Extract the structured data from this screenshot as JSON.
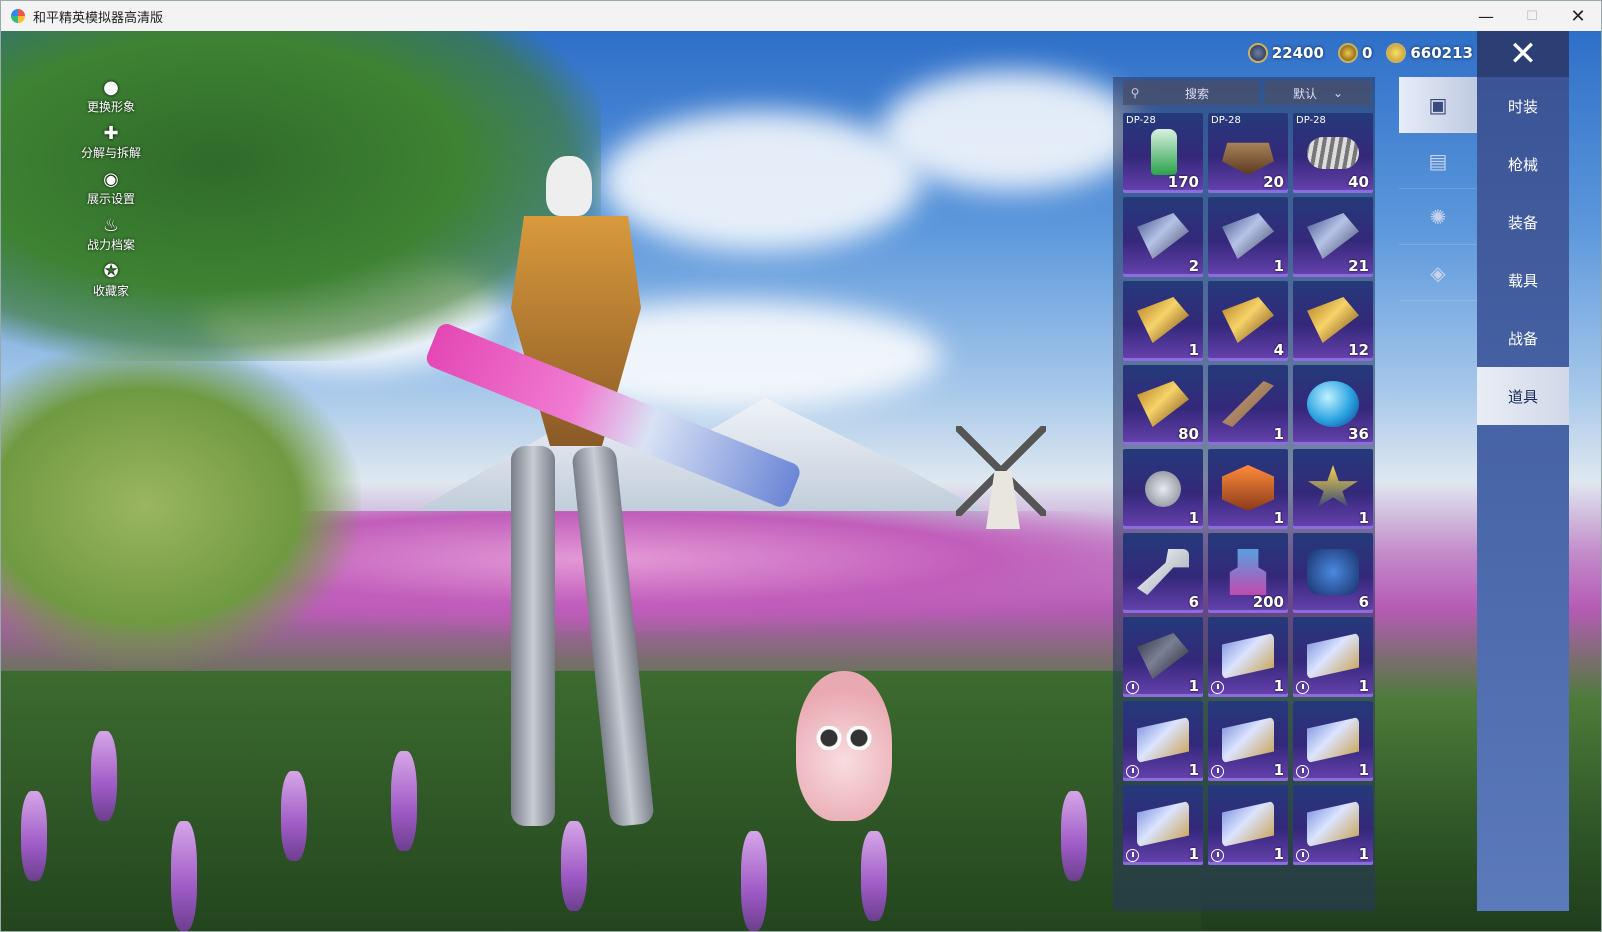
{
  "window": {
    "title": "和平精英模拟器高清版",
    "minimize": "—",
    "maximize": "☐",
    "close": "✕"
  },
  "left_menu": [
    {
      "label": "更换形象",
      "icon": "person-icon"
    },
    {
      "label": "分解与拆解",
      "icon": "puzzle-icon"
    },
    {
      "label": "展示设置",
      "icon": "eye-icon"
    },
    {
      "label": "战力档案",
      "icon": "fire-icon"
    },
    {
      "label": "收藏家",
      "icon": "collector-badge-icon"
    }
  ],
  "currency": [
    {
      "value": "22400",
      "icon": "silver-coin-icon",
      "color": "#6f7fa3"
    },
    {
      "value": "0",
      "icon": "gold-triangle-coin-icon",
      "color": "#f1c94a"
    },
    {
      "value": "660213",
      "icon": "gold-coin-icon",
      "color": "#f7e06d"
    }
  ],
  "search": {
    "placeholder": "搜索"
  },
  "sort": {
    "selected": "默认"
  },
  "tabs": [
    {
      "icon": "card-icon",
      "active": true
    },
    {
      "icon": "chest-icon",
      "active": false
    },
    {
      "icon": "firework-icon",
      "active": false
    },
    {
      "icon": "ticket-icon",
      "active": false
    }
  ],
  "categories": [
    {
      "label": "时装"
    },
    {
      "label": "枪械"
    },
    {
      "label": "装备"
    },
    {
      "label": "载具"
    },
    {
      "label": "战备"
    },
    {
      "label": "道具",
      "active": true
    }
  ],
  "close_label": "✕",
  "items": [
    {
      "tag": "DP-28",
      "count": "170",
      "icon": "spray-can",
      "timed": false
    },
    {
      "tag": "DP-28",
      "count": "20",
      "icon": "crate",
      "timed": false
    },
    {
      "tag": "DP-28",
      "count": "40",
      "icon": "spring",
      "timed": false
    },
    {
      "tag": "",
      "count": "2",
      "icon": "exp-card-1day-x1.5",
      "timed": false
    },
    {
      "tag": "",
      "count": "1",
      "icon": "exp-card-3day-x1.5",
      "timed": false
    },
    {
      "tag": "",
      "count": "21",
      "icon": "exp-card-3day-x2",
      "timed": false
    },
    {
      "tag": "",
      "count": "1",
      "icon": "gold-card-1day-x1.5",
      "timed": false
    },
    {
      "tag": "",
      "count": "4",
      "icon": "gold-card-1day-x2",
      "timed": false
    },
    {
      "tag": "",
      "count": "12",
      "icon": "gold-card-3day-x2",
      "timed": false
    },
    {
      "tag": "",
      "count": "80",
      "icon": "gold-card-2hour-x2",
      "timed": false
    },
    {
      "tag": "",
      "count": "1",
      "icon": "wooden-stick",
      "timed": false
    },
    {
      "tag": "",
      "count": "36",
      "icon": "puzzle-orb",
      "timed": false
    },
    {
      "tag": "",
      "count": "1",
      "icon": "thumbs-coin",
      "timed": false
    },
    {
      "tag": "",
      "count": "1",
      "icon": "fist-medal",
      "timed": false
    },
    {
      "tag": "",
      "count": "1",
      "icon": "star-badge",
      "timed": false
    },
    {
      "tag": "",
      "count": "6",
      "icon": "silver-key",
      "timed": false
    },
    {
      "tag": "",
      "count": "200",
      "icon": "spray-gun",
      "timed": false
    },
    {
      "tag": "",
      "count": "6",
      "icon": "puzzle-piece",
      "timed": false
    },
    {
      "tag": "",
      "count": "1",
      "icon": "no-deduct-card",
      "timed": true
    },
    {
      "tag": "",
      "count": "1",
      "icon": "ticket",
      "timed": true
    },
    {
      "tag": "",
      "count": "1",
      "icon": "ticket",
      "timed": true
    },
    {
      "tag": "",
      "count": "1",
      "icon": "ticket",
      "timed": true
    },
    {
      "tag": "",
      "count": "1",
      "icon": "ticket",
      "timed": true
    },
    {
      "tag": "",
      "count": "1",
      "icon": "ticket",
      "timed": true
    },
    {
      "tag": "",
      "count": "1",
      "icon": "ticket",
      "timed": true
    },
    {
      "tag": "",
      "count": "1",
      "icon": "ticket",
      "timed": true
    },
    {
      "tag": "",
      "count": "1",
      "icon": "ticket",
      "timed": true
    }
  ]
}
